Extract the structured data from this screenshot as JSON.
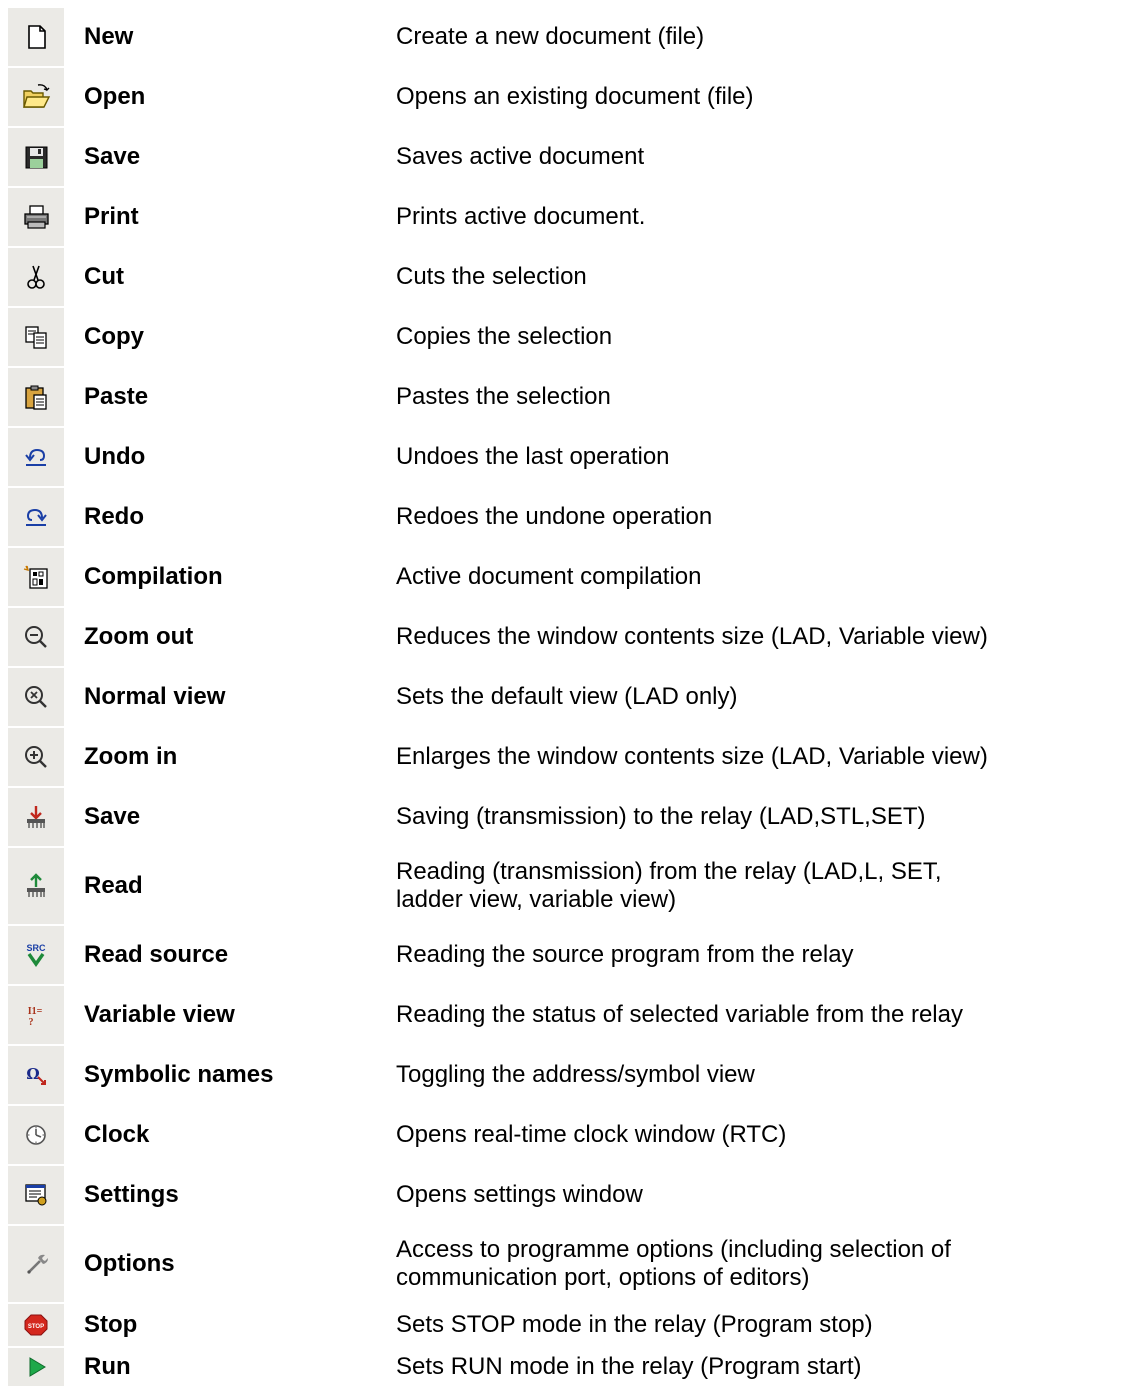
{
  "rows": [
    {
      "name": "New",
      "desc": "Create a new document (file)",
      "icon": "new-document-icon"
    },
    {
      "name": "Open",
      "desc": "Opens an existing document (file)",
      "icon": "open-folder-icon"
    },
    {
      "name": "Save",
      "desc": "Saves active document",
      "icon": "save-disk-icon"
    },
    {
      "name": "Print",
      "desc": "Prints active document.",
      "icon": "printer-icon"
    },
    {
      "name": "Cut",
      "desc": "Cuts the selection",
      "icon": "scissors-icon"
    },
    {
      "name": "Copy",
      "desc": "Copies the selection",
      "icon": "copy-icon"
    },
    {
      "name": "Paste",
      "desc": "Pastes the selection",
      "icon": "paste-clipboard-icon"
    },
    {
      "name": "Undo",
      "desc": "Undoes the last operation",
      "icon": "undo-icon"
    },
    {
      "name": "Redo",
      "desc": "Redoes the undone operation",
      "icon": "redo-icon"
    },
    {
      "name": "Compilation",
      "desc": "Active document compilation",
      "icon": "compile-icon"
    },
    {
      "name": "Zoom out",
      "desc": "Reduces the window contents size (LAD, Variable view)",
      "icon": "zoom-out-icon"
    },
    {
      "name": "Normal view",
      "desc": "Sets the default view (LAD only)",
      "icon": "normal-view-icon"
    },
    {
      "name": "Zoom in",
      "desc": "Enlarges the window contents size (LAD, Variable view)",
      "icon": "zoom-in-icon"
    },
    {
      "name": "Save",
      "desc": "Saving (transmission) to the relay (LAD,STL,SET)",
      "icon": "save-to-relay-icon"
    },
    {
      "name": "Read",
      "desc_line1": "Reading (transmission) from the relay (LAD,L, SET,",
      "desc_line2": "ladder view, variable view)",
      "icon": "read-from-relay-icon"
    },
    {
      "name": "Read source",
      "desc": "Reading the source program from the relay",
      "icon": "read-source-icon",
      "icon_text": "SRC"
    },
    {
      "name": "Variable view",
      "desc": "Reading the status of selected variable from the relay",
      "icon": "variable-view-icon",
      "icon_text": "I1="
    },
    {
      "name": "Symbolic names",
      "desc": "Toggling the address/symbol view",
      "icon": "symbolic-names-icon",
      "icon_text": "Ω"
    },
    {
      "name": "Clock",
      "desc": "Opens real-time clock window (RTC)",
      "icon": "clock-icon"
    },
    {
      "name": "Settings",
      "desc": "Opens settings window",
      "icon": "settings-icon"
    },
    {
      "name": "Options",
      "desc_line1": "Access to programme options (including selection of",
      "desc_line2": "communication port, options of editors)",
      "icon": "wrench-icon"
    },
    {
      "name": "Stop",
      "desc": "Sets STOP mode in the relay (Program stop)",
      "icon": "stop-sign-icon",
      "icon_text": "STOP"
    },
    {
      "name": "Run",
      "desc": "Sets RUN mode in the relay (Program start)",
      "icon": "run-play-icon"
    }
  ]
}
